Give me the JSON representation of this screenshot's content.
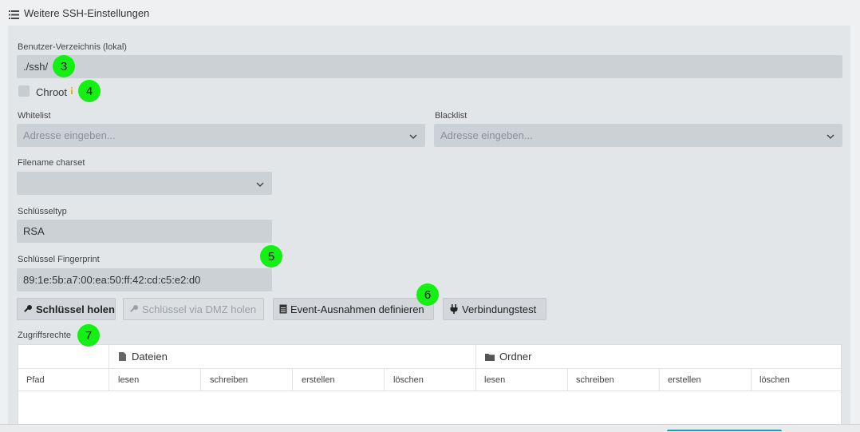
{
  "header": {
    "title": "Weitere SSH-Einstellungen"
  },
  "form": {
    "user_dir_label": "Benutzer-Verzeichnis (lokal)",
    "user_dir_value": "./ssh/",
    "chroot_label": "Chroot",
    "whitelist_label": "Whitelist",
    "whitelist_placeholder": "Adresse eingeben...",
    "blacklist_label": "Blacklist",
    "blacklist_placeholder": "Adresse eingeben...",
    "charset_label": "Filename charset",
    "charset_value": "",
    "keytype_label": "Schlüsseltyp",
    "keytype_value": "RSA",
    "fingerprint_label": "Schlüssel Fingerprint",
    "fingerprint_value": "89:1e:5b:a7:00:ea:50:ff:42:cd:c5:e2:d0"
  },
  "buttons": {
    "get_key": "Schlüssel holen",
    "get_key_dmz": "Schlüssel via DMZ holen",
    "event_exceptions": "Event-Ausnahmen definieren",
    "connection_test": "Verbindungstest"
  },
  "access": {
    "title": "Zugriffsrechte",
    "group_files": "Dateien",
    "group_folders": "Ordner",
    "columns": [
      "Pfad",
      "lesen",
      "schreiben",
      "erstellen",
      "löschen",
      "lesen",
      "schreiben",
      "erstellen",
      "löschen"
    ]
  },
  "badges": [
    "3",
    "4",
    "5",
    "6",
    "7"
  ],
  "colors": {
    "badge": "#14f014",
    "panel": "#e3e6e9",
    "input": "#ccd1d6"
  }
}
